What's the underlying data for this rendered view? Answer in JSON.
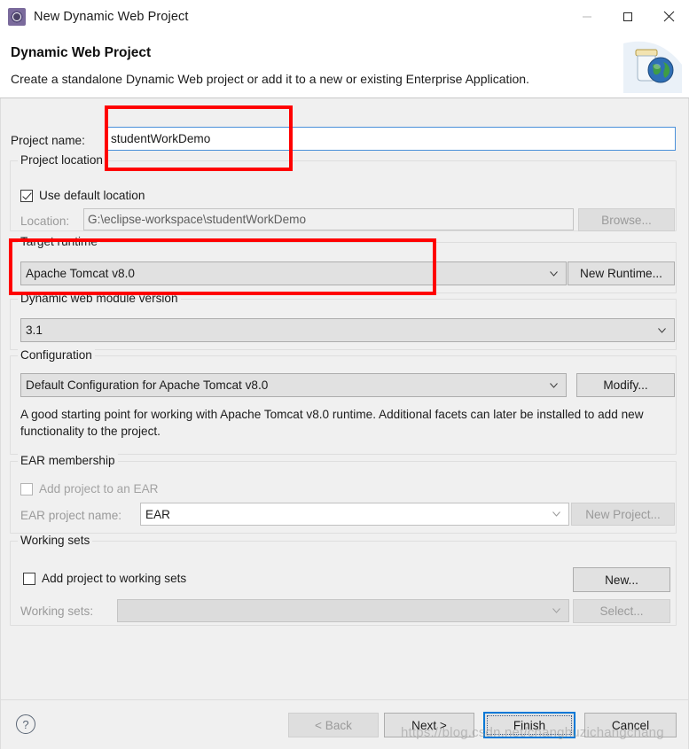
{
  "window": {
    "title": "New Dynamic Web Project",
    "app_icon": "gear-icon",
    "minimize_icon": "minimize-icon",
    "maximize_icon": "maximize-icon",
    "close_icon": "close-icon"
  },
  "header": {
    "title": "Dynamic Web Project",
    "description": "Create a standalone Dynamic Web project or add it to a new or existing Enterprise Application.",
    "icon": "jar-globe-icon"
  },
  "form": {
    "project_name": {
      "label": "Project name:",
      "value": "studentWorkDemo",
      "placeholder": ""
    },
    "project_location": {
      "group_title": "Project location",
      "use_default_label": "Use default location",
      "use_default_checked": true,
      "location_label": "Location:",
      "location_value": "G:\\eclipse-workspace\\studentWorkDemo",
      "browse_label": "Browse..."
    },
    "target_runtime": {
      "group_title": "Target runtime",
      "value": "Apache Tomcat v8.0",
      "new_runtime_label": "New Runtime..."
    },
    "module_version": {
      "group_title": "Dynamic web module version",
      "value": "3.1"
    },
    "configuration": {
      "group_title": "Configuration",
      "value": "Default Configuration for Apache Tomcat v8.0",
      "modify_label": "Modify...",
      "description": "A good starting point for working with Apache Tomcat v8.0 runtime. Additional facets can later be installed to add new functionality to the project."
    },
    "ear_membership": {
      "group_title": "EAR membership",
      "add_to_ear_label": "Add project to an EAR",
      "add_to_ear_checked": false,
      "ear_name_label": "EAR project name:",
      "ear_name_value": "EAR",
      "new_project_label": "New Project..."
    },
    "working_sets": {
      "group_title": "Working sets",
      "add_to_working_sets_label": "Add project to working sets",
      "add_to_working_sets_checked": false,
      "working_sets_label": "Working sets:",
      "working_sets_value": "",
      "new_label": "New...",
      "select_label": "Select..."
    }
  },
  "footer": {
    "help_icon": "question-mark-icon",
    "back_label": "< Back",
    "next_label": "Next >",
    "finish_label": "Finish",
    "cancel_label": "Cancel"
  },
  "watermark": {
    "text": "https://blog.csdn.net/changhuzichangchang"
  },
  "colors": {
    "annotation": "#ff0000",
    "focus": "#0078d7",
    "dialog_bg": "#f0f0f0"
  }
}
